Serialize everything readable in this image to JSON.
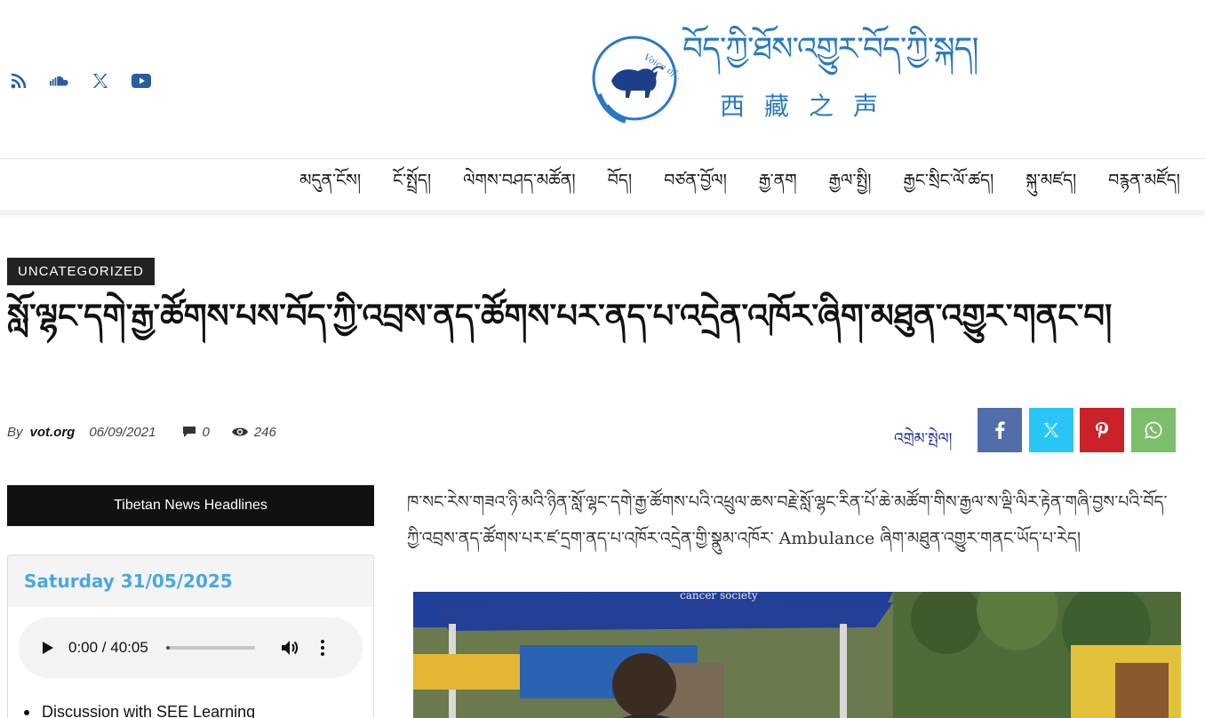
{
  "header": {
    "social_icons": [
      "rss-icon",
      "soundcloud-icon",
      "x-icon",
      "youtube-icon"
    ],
    "logo": {
      "seal_text": "Voice of Tibet",
      "tibetan": "བོད་ཀྱི་ཐོས་འགྱུར་བོད་ཀྱི་སྐད།",
      "chinese": "西藏之声"
    }
  },
  "nav": {
    "items": [
      "མདུན་ངོས།",
      "ངོ་སྤྲོད།",
      "ལེགས་བཤད་མཚོན།",
      "བོད།",
      "བཙན་བྱོལ།",
      "རྒྱ་ནག",
      "རྒྱལ་སྤྱི།",
      "རྒྱང་སྲིང་ལོ་ཚད།",
      "སྐུ་མཛད།",
      "བརྙན་མཛོད།"
    ]
  },
  "article": {
    "category": "UNCATEGORIZED",
    "title": "སློ་ལྷང་དགེ་རྒྱ་ཚོགས་པས་བོད་ཀྱི་འབྲས་ནད་ཚོགས་པར་ནད་པ་འདྲེན་འཁོར་ཞིག་མཐུན་འགྱུར་གནང་བ།",
    "by_label": "By",
    "author": "vot.org",
    "date": "06/09/2021",
    "comments": "0",
    "views": "246",
    "share_label": "འགྲེམ་སྤེལ།",
    "body": "ཁ་སང་རེས་གཟའ་ཉི་མའི་ཉིན་སློ་ལྷང་དགེ་རྒྱ་ཚོགས་པའི་འཕྲུལ་ཆས་བརྗེ་སློ་ལྷང་རིན་པོ་ཆེ་མཚོག་གིས་རྒྱལ་ས་ལྡི་ལིར་རྟེན་གཞི་བྱས་པའི་བོད་ཀྱི་འབྲས་ནད་ཚོགས་པར་ཛ་དྲག་ནད་པ་འཁོར་འདྲེན་གྱི་སྣུམ་འཁོར་ Ambulance ཞིག་མཐུན་འགྱུར་གནང་ཡོད་པ་རེད།"
  },
  "share_buttons": [
    {
      "name": "facebook",
      "icon": "facebook-icon",
      "color": "#516eab"
    },
    {
      "name": "x",
      "icon": "x-icon",
      "color": "#29c5f6"
    },
    {
      "name": "pinterest",
      "icon": "pinterest-icon",
      "color": "#ca212a"
    },
    {
      "name": "whatsapp",
      "icon": "whatsapp-icon",
      "color": "#7bbf6a"
    }
  ],
  "sidebar": {
    "heading": "Tibetan News Headlines",
    "date": "Saturday 31/05/2025",
    "player": {
      "time": "0:00 / 40:05",
      "progress": 0.0
    },
    "list": [
      "Discussion with SEE Learning"
    ]
  },
  "colors": {
    "brand_blue": "#2a78c2",
    "date_blue": "#4aa8e0",
    "share_label": "#1b2a8f"
  }
}
